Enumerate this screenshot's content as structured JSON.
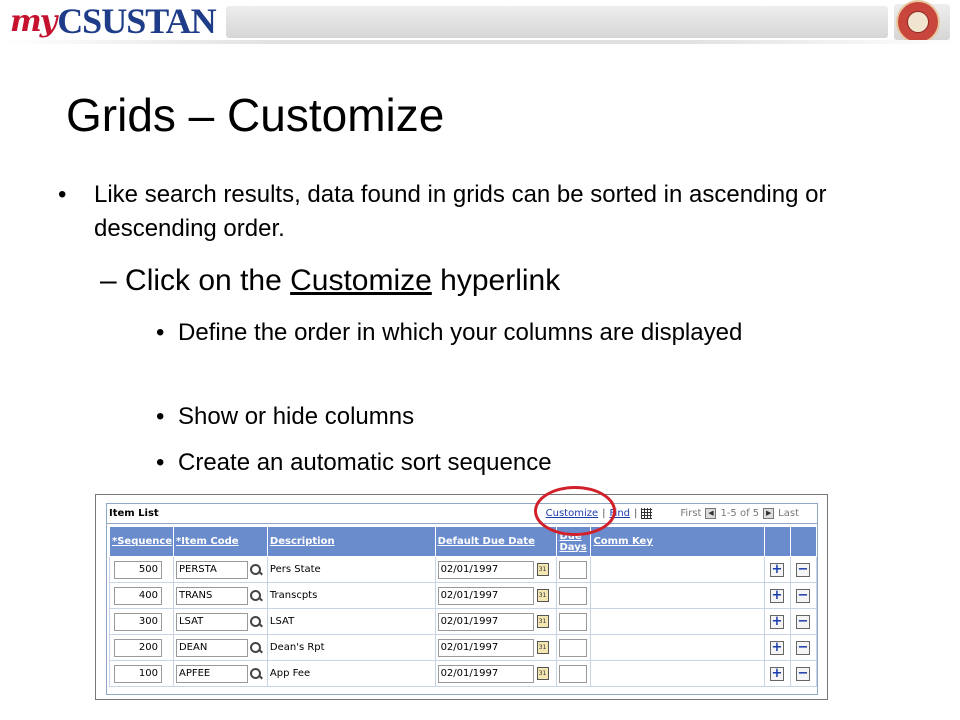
{
  "banner": {
    "logo_prefix": "my",
    "logo_main": "CSUSTAN"
  },
  "slide": {
    "title": "Grids – Customize",
    "bullet_symbol": "•",
    "dash_symbol": "–",
    "bullet1": "Like search results, data found in grids can be sorted in ascending or descending order.",
    "sub_pre": "Click on the ",
    "sub_link": "Customize",
    "sub_post": " hyperlink",
    "points": [
      "Define the order in which your columns are displayed",
      "Show or hide columns",
      "Create an automatic sort sequence"
    ]
  },
  "grid": {
    "title": "Item List",
    "tools": {
      "customize": "Customize",
      "sep": "|",
      "find": "Find",
      "first": "First",
      "range": "1-5 of 5",
      "last": "Last"
    },
    "columns": [
      "*Sequence",
      "*Item Code",
      "Description",
      "Default Due Date",
      "Due Days",
      "Comm Key"
    ],
    "rows": [
      {
        "seq": "500",
        "code": "PERSTA",
        "desc": "Pers State",
        "date": "02/01/1997"
      },
      {
        "seq": "400",
        "code": "TRANS",
        "desc": "Transcpts",
        "date": "02/01/1997"
      },
      {
        "seq": "300",
        "code": "LSAT",
        "desc": "LSAT",
        "date": "02/01/1997"
      },
      {
        "seq": "200",
        "code": "DEAN",
        "desc": "Dean's Rpt",
        "date": "02/01/1997"
      },
      {
        "seq": "100",
        "code": "APFEE",
        "desc": "App Fee",
        "date": "02/01/1997"
      }
    ],
    "add_symbol": "+",
    "remove_symbol": "−",
    "cal_label": "31"
  },
  "colors": {
    "header_bg": "#6b8ccc",
    "highlight_circle": "#d2202a",
    "brand_red": "#c4122f",
    "brand_blue": "#1f3c88"
  }
}
